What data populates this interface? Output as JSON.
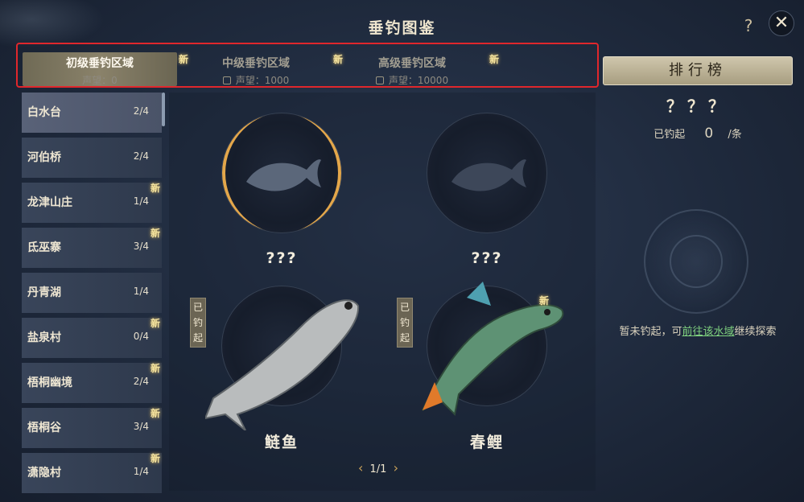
{
  "header": {
    "title": "垂钓图鉴",
    "help_label": "?",
    "close_label": "✕"
  },
  "tabs": [
    {
      "label": "初级垂钓区域",
      "requirement": "声望：0",
      "new": "新"
    },
    {
      "label": "中级垂钓区域",
      "requirement": "声望：1000",
      "new": "新"
    },
    {
      "label": "高级垂钓区域",
      "requirement": "声望：10000",
      "new": "新"
    }
  ],
  "sidebar": {
    "items": [
      {
        "label": "白水台",
        "count": "2/4"
      },
      {
        "label": "河伯桥",
        "count": "2/4"
      },
      {
        "label": "龙津山庄",
        "count": "1/4",
        "new": "新"
      },
      {
        "label": "氐巫寨",
        "count": "3/4",
        "new": "新"
      },
      {
        "label": "丹青湖",
        "count": "1/4"
      },
      {
        "label": "盐泉村",
        "count": "0/4",
        "new": "新"
      },
      {
        "label": "梧桐幽境",
        "count": "2/4",
        "new": "新"
      },
      {
        "label": "梧桐谷",
        "count": "3/4",
        "new": "新"
      },
      {
        "label": "潇隐村",
        "count": "1/4",
        "new": "新"
      }
    ]
  },
  "fish": [
    {
      "name": "???"
    },
    {
      "name": "???"
    },
    {
      "name": "鲢鱼",
      "caught_tag": "已钓起"
    },
    {
      "name": "春鲤",
      "caught_tag": "已钓起",
      "new": "新"
    }
  ],
  "pager": {
    "prev": "‹",
    "page": "1/1",
    "next": "›"
  },
  "right_panel": {
    "rank_label": "排行榜",
    "fish_name": "？？？",
    "caught_label": "已钓起",
    "caught_count": "0",
    "caught_unit": "/条",
    "hint_prefix": "暂未钓起，可",
    "hint_link": "前往该水域",
    "hint_suffix": "继续探索"
  },
  "colors": {
    "highlight_border": "#e0272c",
    "link": "#7fd17f",
    "new_tag": "#f3e3a0"
  }
}
